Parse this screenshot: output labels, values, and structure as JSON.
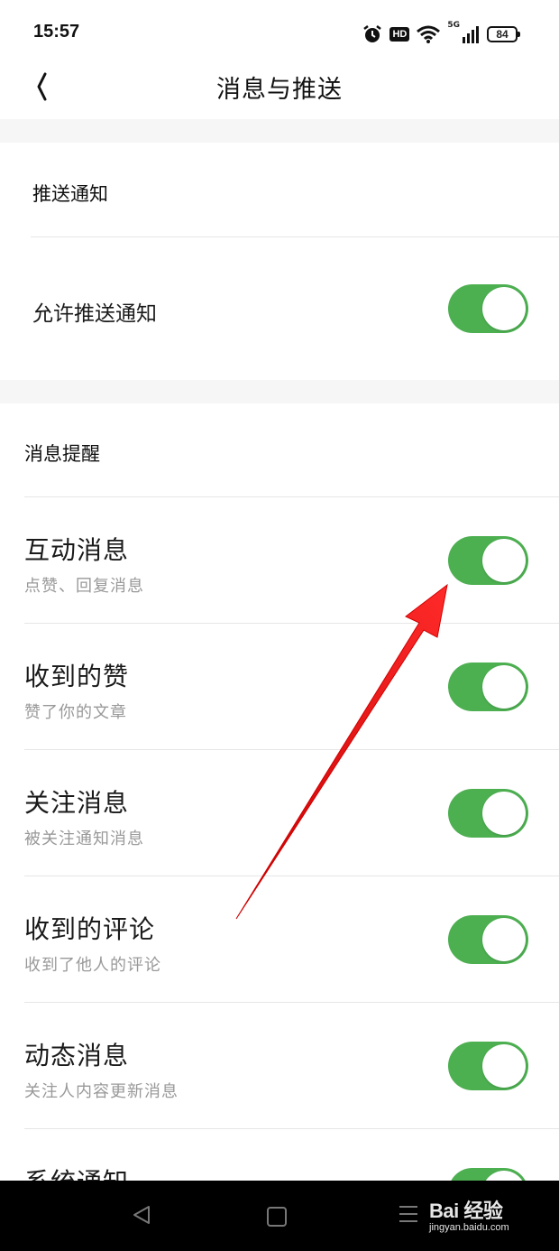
{
  "status_bar": {
    "time": "15:57",
    "hd": "HD",
    "network": "5G",
    "battery": "84"
  },
  "header": {
    "title": "消息与推送"
  },
  "push_section": {
    "label": "推送通知",
    "allow_push": {
      "label": "允许推送通知",
      "enabled": true
    }
  },
  "message_section": {
    "label": "消息提醒",
    "items": [
      {
        "title": "互动消息",
        "subtitle": "点赞、回复消息",
        "enabled": true
      },
      {
        "title": "收到的赞",
        "subtitle": "赞了你的文章",
        "enabled": true
      },
      {
        "title": "关注消息",
        "subtitle": "被关注通知消息",
        "enabled": true
      },
      {
        "title": "收到的评论",
        "subtitle": "收到了他人的评论",
        "enabled": true
      },
      {
        "title": "动态消息",
        "subtitle": "关注人内容更新消息",
        "enabled": true
      },
      {
        "title": "系统通知",
        "enabled": true
      }
    ]
  },
  "watermark": {
    "logo": "Bai 经验",
    "url": "jingyan.baidu.com"
  },
  "colors": {
    "toggle_on": "#4caf50",
    "arrow": "#e02020"
  }
}
